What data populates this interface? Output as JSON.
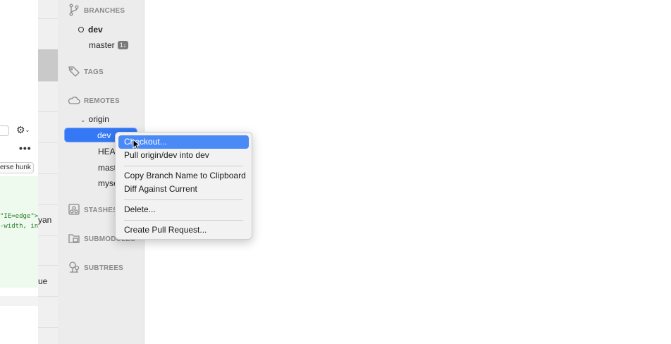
{
  "left_pane": {
    "hunk_button_label": "erse hunk",
    "code_lines": [
      "\"IE=edge\">",
      "-width, in:"
    ]
  },
  "gutter": {
    "text_1": "yan",
    "text_2": "ue"
  },
  "sidebar": {
    "branches": {
      "header": "BRANCHES",
      "items": [
        {
          "label": "dev",
          "current": true
        },
        {
          "label": "master",
          "badge": "1↓"
        }
      ]
    },
    "tags": {
      "header": "TAGS"
    },
    "remotes": {
      "header": "REMOTES",
      "origin": {
        "label": "origin",
        "items": [
          "dev",
          "HEAD",
          "mast",
          "myse"
        ]
      }
    },
    "stashes": {
      "header": "STASHES"
    },
    "submodules": {
      "header": "SUBMODULES"
    },
    "subtrees": {
      "header": "SUBTREES"
    }
  },
  "context_menu": {
    "items": [
      {
        "label": "Checkout...",
        "active": true
      },
      {
        "label": "Pull origin/dev into dev"
      },
      {
        "separator": true
      },
      {
        "label": "Copy Branch Name to Clipboard"
      },
      {
        "label": "Diff Against Current"
      },
      {
        "separator": true
      },
      {
        "label": "Delete..."
      },
      {
        "separator": true
      },
      {
        "label": "Create Pull Request..."
      }
    ]
  },
  "colors": {
    "selection": "#3478f6",
    "menu_highlight": "#4a8af7",
    "diff_added_bg": "#edfaed"
  }
}
